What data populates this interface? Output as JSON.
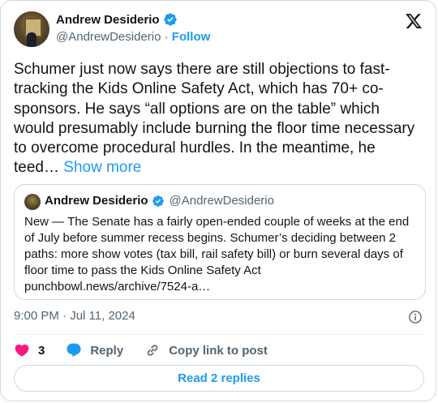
{
  "author": {
    "name": "Andrew Desiderio",
    "handle": "@AndrewDesiderio",
    "separator": "·",
    "follow_label": "Follow"
  },
  "tweet": {
    "text": "Schumer just now says there are still objections to fast-tracking the Kids Online Safety Act, which has 70+ co-sponsors. He says “all options are on the table” which would presumably include burning the floor time necessary to overcome procedural hurdles. In the meantime, he teed…",
    "show_more_label": "Show more"
  },
  "quoted_tweet": {
    "name": "Andrew Desiderio",
    "handle": "@AndrewDesiderio",
    "text": "New — The Senate has a fairly open-ended couple of weeks at the end of July before summer recess begins. Schumer’s deciding between 2 paths: more show votes (tax bill, rail safety bill) or burn several days of floor time to pass the Kids Online Safety Act punchbowl.news/archive/7524-a…"
  },
  "meta": {
    "timestamp": "9:00 PM · Jul 11, 2024"
  },
  "actions": {
    "like_count": "3",
    "reply_label": "Reply",
    "copy_link_label": "Copy link to post"
  },
  "read_replies_label": "Read 2 replies",
  "icons": {
    "verified": "verified-badge-icon",
    "brand": "x-logo-icon",
    "info": "info-icon",
    "like": "heart-icon",
    "reply": "reply-bubble-icon",
    "copy": "link-icon"
  },
  "colors": {
    "accent": "#1d9bf0",
    "like": "#f91880",
    "secondary_text": "#536471",
    "border": "#cfd9de"
  }
}
